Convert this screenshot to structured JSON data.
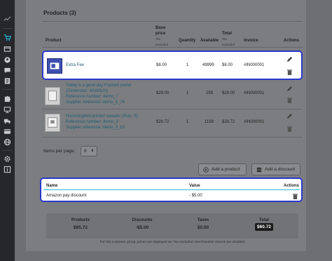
{
  "panel": {
    "title": "Products (3)"
  },
  "table": {
    "headers": {
      "product": "Product",
      "base_price": "Base price",
      "base_price_sub": "Tax excluded",
      "quantity": "Quantity",
      "available": "Available",
      "total": "Total",
      "total_sub": "Tax excluded",
      "invoice": "Invoice",
      "actions": "Actions"
    },
    "rows": [
      {
        "name": "Extra Fee",
        "base_price": "$8.00",
        "quantity": "1",
        "available": "49999",
        "total": "$8.00",
        "invoice": "#IN000001"
      },
      {
        "name": "Today is a good day Framed poster",
        "line2": "(Dimension: 40x60cm)",
        "line3": "Reference number: demo_7",
        "line4": "Supplier reference: demo_3_76",
        "base_price": "$29.00",
        "quantity": "1",
        "available": "299",
        "total": "$29.00",
        "invoice": "#IN000001"
      },
      {
        "name": "Hummingbird printed sweater (Size: S)",
        "line2": "Reference number: demo_3",
        "line3": "Supplier reference: demo_3_62",
        "base_price": "$28.72",
        "quantity": "1",
        "available": "1199",
        "total": "$28.72",
        "invoice": "#IN000001"
      }
    ]
  },
  "pagination": {
    "label": "Items per page:",
    "value": "8"
  },
  "buttons": {
    "add_product": "Add a product",
    "add_discount": "Add a discount"
  },
  "discounts": {
    "headers": {
      "name": "Name",
      "value": "Value",
      "actions": "Actions"
    },
    "rows": [
      {
        "name": "Amazon pay discount",
        "value": "- $5.00"
      }
    ]
  },
  "totals": {
    "products_label": "Products",
    "products_value": "$65.72",
    "discounts_label": "Discounts",
    "discounts_value": "-$5.00",
    "taxes_label": "Taxes",
    "taxes_value": "$0.00",
    "total_label": "Total",
    "total_value": "$60.72"
  },
  "footnote": "For this customer group, prices are displayed as: Tax excluded. Merchandise returns are disabled",
  "sidebar_icons": [
    "trend-icon",
    "cart-icon",
    "store-icon",
    "people-icon",
    "chat-icon",
    "chart-icon",
    "puzzle-icon",
    "monitor-icon",
    "truck-icon",
    "card-icon",
    "globe-icon",
    "gear-icon",
    "info-icon"
  ],
  "colors": {
    "highlight": "#2a39c9",
    "link": "#1b5e73",
    "accent": "#25b9d7"
  }
}
